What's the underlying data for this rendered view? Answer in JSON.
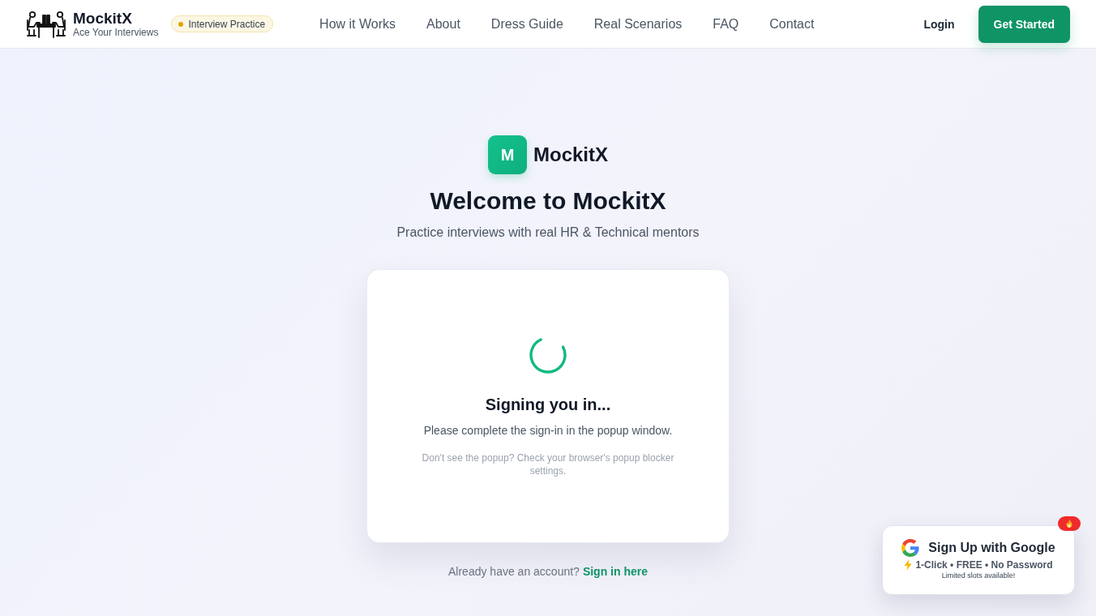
{
  "header": {
    "brand": "MockitX",
    "tagline": "Ace Your Interviews",
    "badge": "Interview Practice",
    "nav": [
      "How it Works",
      "About",
      "Dress Guide",
      "Real Scenarios",
      "FAQ",
      "Contact"
    ],
    "login": "Login",
    "cta": "Get Started"
  },
  "hero": {
    "logo_letter": "M",
    "brand": "MockitX",
    "title": "Welcome to MockitX",
    "subtitle": "Practice interviews with real HR & Technical mentors"
  },
  "card": {
    "title": "Signing you in...",
    "message": "Please complete the sign-in in the popup window.",
    "note": "Don't see the popup? Check your browser's popup blocker settings."
  },
  "account_prompt": {
    "text": "Already have an account?",
    "link": "Sign in here"
  },
  "promo": {
    "title": "Sign Up with Google",
    "features": "1-Click • FREE • No Password",
    "note": "Limited slots available!"
  }
}
